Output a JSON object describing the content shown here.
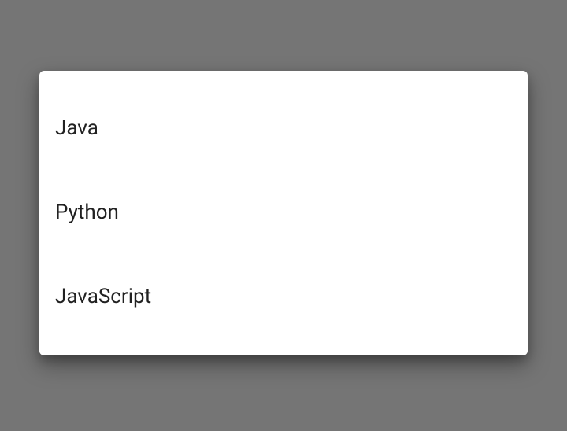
{
  "dialog": {
    "items": [
      {
        "label": "Java"
      },
      {
        "label": "Python"
      },
      {
        "label": "JavaScript"
      }
    ]
  }
}
